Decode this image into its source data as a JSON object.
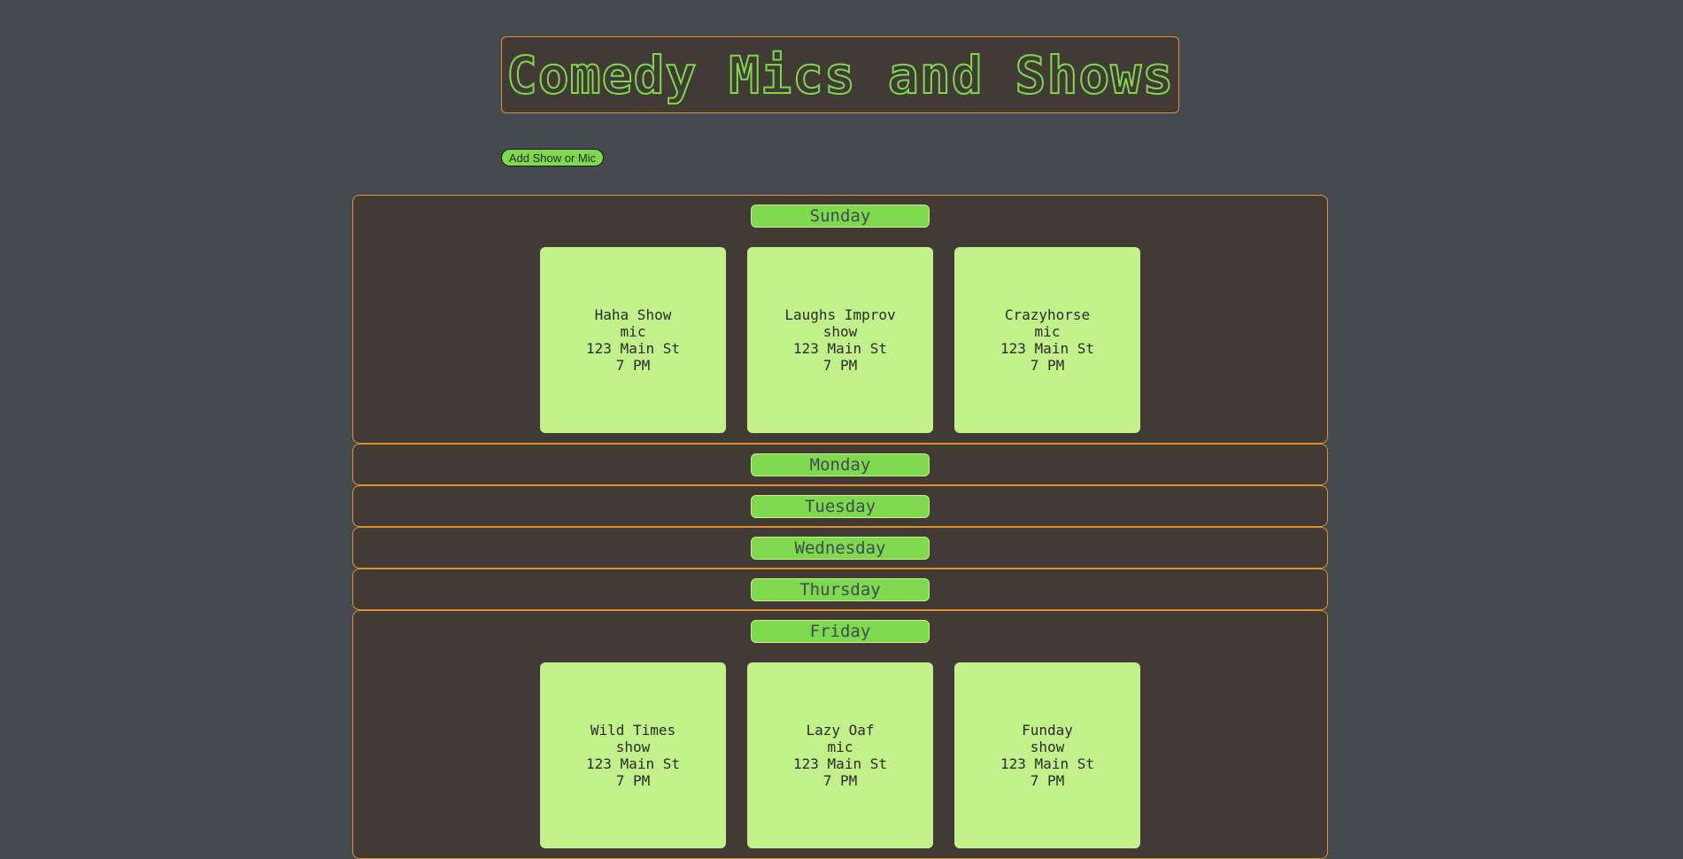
{
  "page": {
    "title": "Comedy Mics and Shows",
    "add_button_label": "Add Show or Mic"
  },
  "colors": {
    "background": "#454a4f",
    "panel": "#413a35",
    "border": "#e0922e",
    "accent_green": "#7ed94f",
    "card_green": "#c2f08a"
  },
  "days": [
    {
      "name": "Sunday",
      "events": [
        {
          "name": "Haha Show",
          "type": "mic",
          "address": "123 Main St",
          "time": "7 PM"
        },
        {
          "name": "Laughs Improv",
          "type": "show",
          "address": "123 Main St",
          "time": "7 PM"
        },
        {
          "name": "Crazyhorse",
          "type": "mic",
          "address": "123 Main St",
          "time": "7 PM"
        }
      ]
    },
    {
      "name": "Monday",
      "events": []
    },
    {
      "name": "Tuesday",
      "events": []
    },
    {
      "name": "Wednesday",
      "events": []
    },
    {
      "name": "Thursday",
      "events": []
    },
    {
      "name": "Friday",
      "events": [
        {
          "name": "Wild Times",
          "type": "show",
          "address": "123 Main St",
          "time": "7 PM"
        },
        {
          "name": "Lazy Oaf",
          "type": "mic",
          "address": "123 Main St",
          "time": "7 PM"
        },
        {
          "name": "Funday",
          "type": "show",
          "address": "123 Main St",
          "time": "7 PM"
        }
      ]
    }
  ]
}
